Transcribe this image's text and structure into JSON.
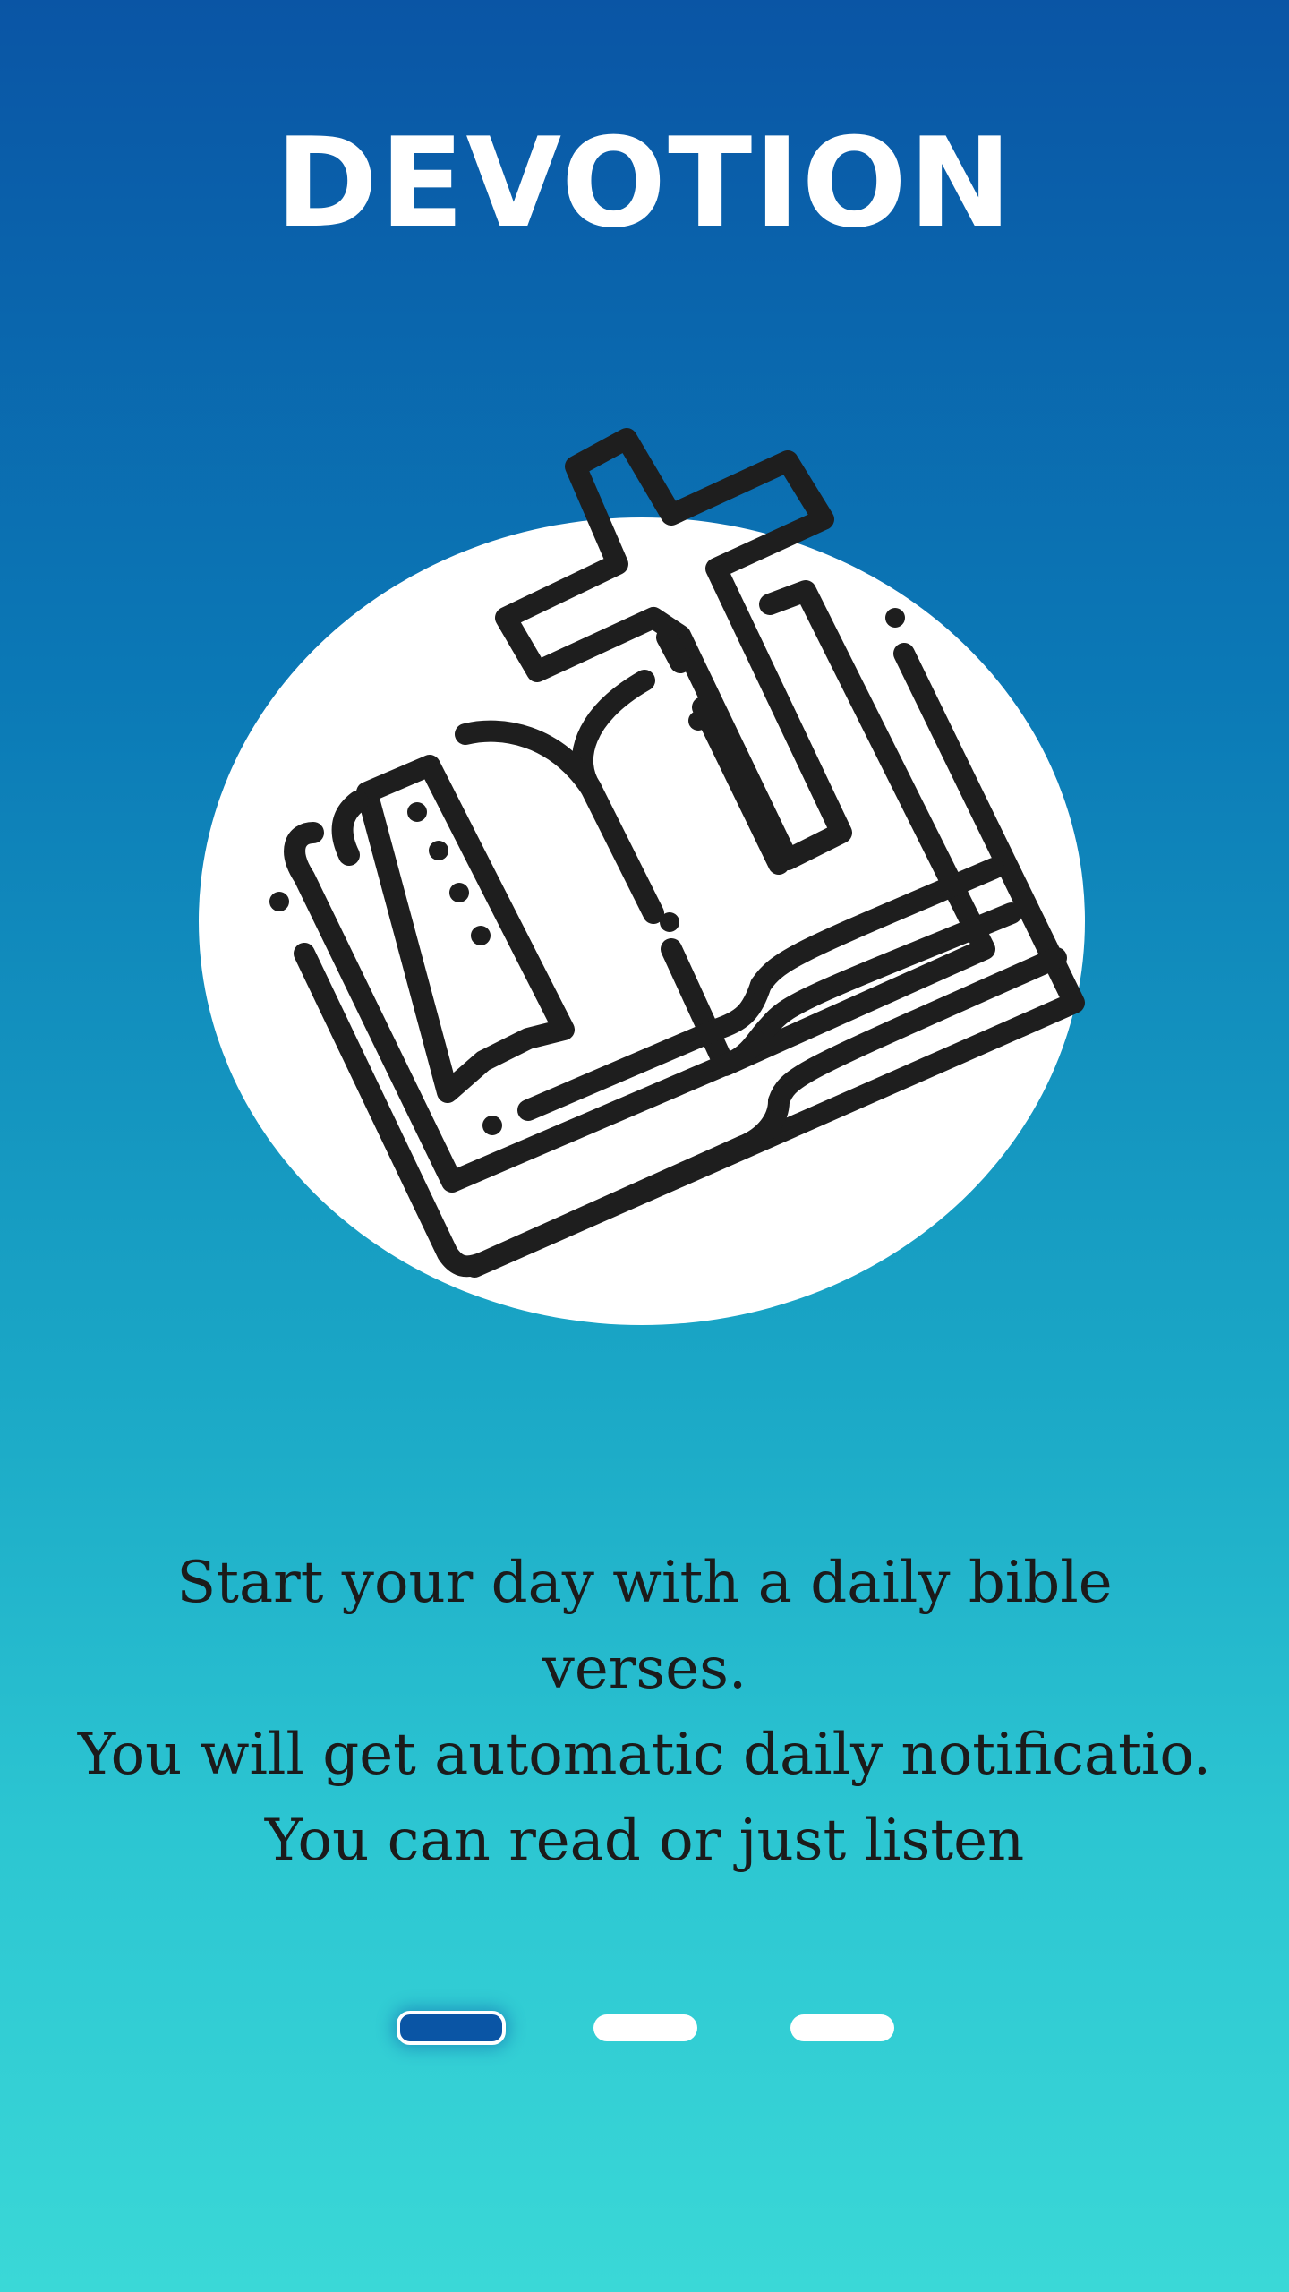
{
  "title": "DEVOTION",
  "illustration": {
    "icon": "open-bible-with-cross-icon",
    "circle_color": "#ffffff",
    "stroke_color": "#1e1e1e"
  },
  "description": {
    "line1": "Start your day with a daily bible verses.",
    "line2": "You will get automatic daily notificatio.",
    "line3": "You can read or just listen"
  },
  "pager": {
    "total_pages": 3,
    "current_page": 1,
    "active_color": "#0a55a5",
    "inactive_color": "#ffffff"
  },
  "colors": {
    "gradient_top": "#0a55a5",
    "gradient_bottom": "#3ad8d7",
    "title_color": "#ffffff",
    "text_color": "#1b1b1b"
  }
}
